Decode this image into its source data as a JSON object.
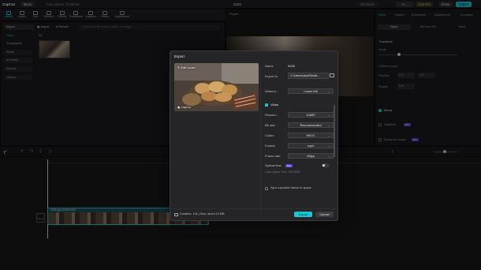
{
  "titlebar": {
    "app_name": "CapCut",
    "menu_label": "Menu",
    "autosave": "Auto saved: 13:58:55",
    "project_name": "0226",
    "shortcuts_label": "Shortcuts",
    "user_label": "A...",
    "join_pro_label": "Join Pro",
    "share_label": "Share",
    "export_label": "Export"
  },
  "toolbar": {
    "tools": [
      "Media",
      "Audio",
      "Text",
      "Stickers",
      "Effects",
      "Transitions",
      "Captions",
      "Filters",
      "Adjustment"
    ]
  },
  "media_panel": {
    "import_label": "Import",
    "record_label": "Record",
    "search_placeholder": "Search for file names, colors, or image...",
    "side_items": [
      "Import",
      "Yours",
      "Subprojects",
      "Stock",
      "AI media",
      "Spaces",
      "Library"
    ],
    "all_label": "All"
  },
  "player": {
    "title": "Player"
  },
  "right_panel": {
    "tabs": [
      "Video",
      "Speed",
      "Animation",
      "Adjustment",
      "AI stylize"
    ],
    "subtabs": [
      "Basic",
      "Remove BG",
      "Mask"
    ],
    "transform_label": "Transform",
    "scale_label": "Scale",
    "uniform_label": "Uniform scale",
    "position_label": "Position",
    "rotate_label": "Rotate",
    "x_value": "0",
    "y_value": "0",
    "rotate_value": "0.0°",
    "blend_label": "Blend",
    "stabilize_label": "Stabilize",
    "enhance_label": "Enhance image",
    "pro_badge": "Pro"
  },
  "dialog": {
    "title": "Export",
    "edit_cover": "Edit cover",
    "watermark_logo": "CapCut",
    "name_label": "Name",
    "name_value": "0226",
    "export_to_label": "Export to",
    "export_to_value": "C:/Users/user/Deskt...",
    "watermark_label": "Waterm...",
    "watermark_value": "Lower left",
    "video_section": "Video",
    "rows": [
      {
        "label": "Resolut...",
        "value": "1080P"
      },
      {
        "label": "Bit rate",
        "value": "Recommended"
      },
      {
        "label": "Codec",
        "value": "HEVC"
      },
      {
        "label": "Format",
        "value": "mp4"
      },
      {
        "label": "Frame rate",
        "value": "30fps"
      }
    ],
    "optical_flow_label": "Optical flow",
    "optical_pro": "Pro",
    "color_space": "Color space: Rec. 709 SDR",
    "sync_label": "Sync exported videos to space",
    "duration_info": "Duration: 19s | Size: about 13 MB",
    "export_button": "Export",
    "cancel_button": "Cancel"
  },
  "timeline": {
    "clip_label": "0226.mp4  00:00:19:00",
    "cover_label": "Cover"
  },
  "colors": {
    "accent": "#19c6d4",
    "clip": "#1d4f56"
  }
}
